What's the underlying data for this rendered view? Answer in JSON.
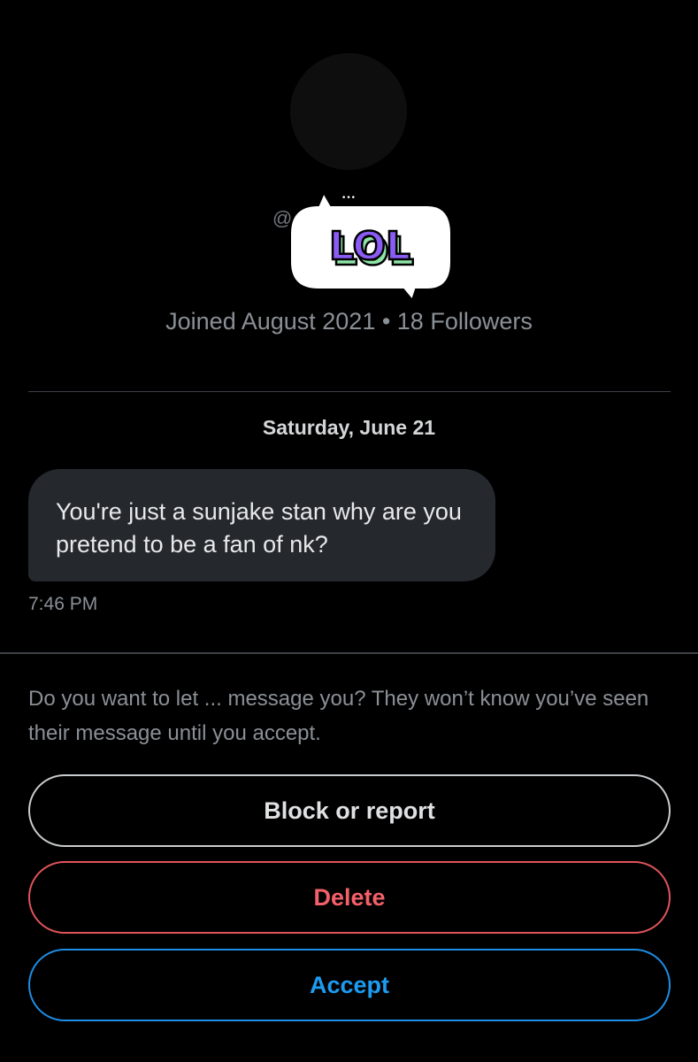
{
  "profile": {
    "handle_prefix": "@",
    "joined": "Joined August 2021 • 18 Followers",
    "sticker_text": "LOL",
    "sticker_dots": "•••"
  },
  "conversation": {
    "date": "Saturday, June 21",
    "messages": [
      {
        "text": "You're just a sunjake stan why are you pretend to be a fan of nk?",
        "time": "7:46 PM"
      }
    ]
  },
  "request": {
    "prompt": "Do you want to let ... message you? They won’t know you’ve seen their message until you accept.",
    "block_label": "Block or report",
    "delete_label": "Delete",
    "accept_label": "Accept"
  },
  "colors": {
    "background": "#000000",
    "bubble": "#25292e",
    "secondary_text": "#8b9096",
    "delete": "#f4606a",
    "accept": "#1d9bf0",
    "sticker_purple": "#8a5cf5",
    "sticker_green": "#8ee4a6"
  },
  "icons": [
    "avatar-placeholder",
    "lol-sticker"
  ]
}
